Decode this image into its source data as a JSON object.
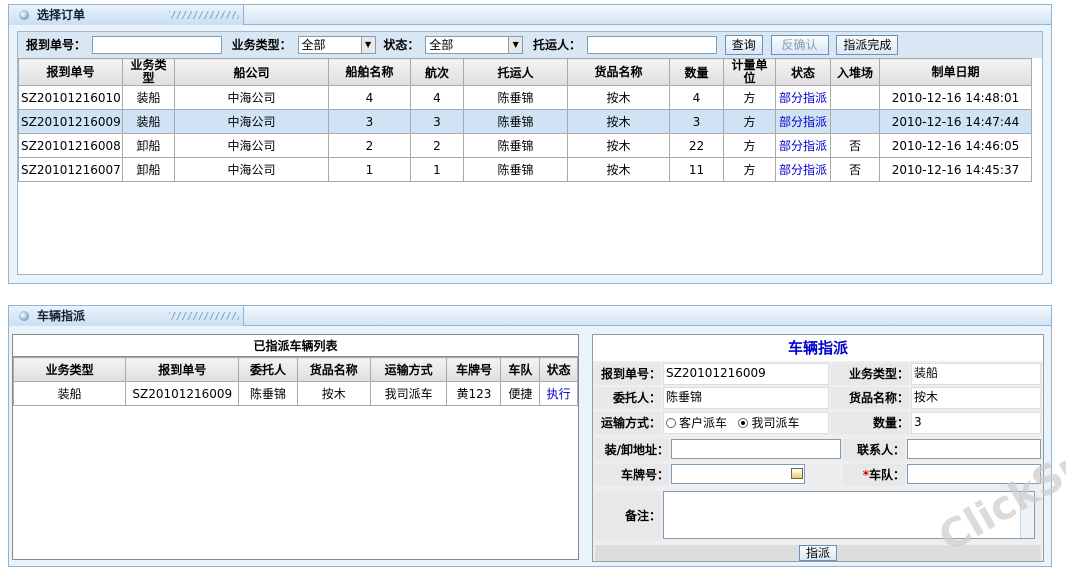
{
  "top_panel": {
    "title": "选择订单",
    "filters": {
      "order_no_label": "报到单号：",
      "order_no_value": "",
      "biz_type_label": "业务类型：",
      "biz_type_value": "全部",
      "status_label": "状态：",
      "status_value": "全部",
      "shipper_label": "托运人：",
      "shipper_value": ""
    },
    "buttons": {
      "query": "查询",
      "unconfirm": "反确认",
      "dispatch_done": "指派完成"
    },
    "columns": [
      "报到单号",
      "业务类型",
      "船公司",
      "船舶名称",
      "航次",
      "托运人",
      "货品名称",
      "数量",
      "计量单位",
      "状态",
      "入堆场",
      "制单日期"
    ],
    "rows": [
      [
        "SZ20101216010",
        "装船",
        "中海公司",
        "4",
        "4",
        "陈垂锦",
        "按木",
        "4",
        "方",
        "部分指派",
        "",
        "2010-12-16 14:48:01"
      ],
      [
        "SZ20101216009",
        "装船",
        "中海公司",
        "3",
        "3",
        "陈垂锦",
        "按木",
        "3",
        "方",
        "部分指派",
        "",
        "2010-12-16 14:47:44"
      ],
      [
        "SZ20101216008",
        "卸船",
        "中海公司",
        "2",
        "2",
        "陈垂锦",
        "按木",
        "22",
        "方",
        "部分指派",
        "否",
        "2010-12-16 14:46:05"
      ],
      [
        "SZ20101216007",
        "卸船",
        "中海公司",
        "1",
        "1",
        "陈垂锦",
        "按木",
        "11",
        "方",
        "部分指派",
        "否",
        "2010-12-16 14:45:37"
      ]
    ],
    "selected_row": 1
  },
  "bottom_panel": {
    "title": "车辆指派",
    "list": {
      "title": "已指派车辆列表",
      "columns": [
        "业务类型",
        "报到单号",
        "委托人",
        "货品名称",
        "运输方式",
        "车牌号",
        "车队",
        "状态"
      ],
      "rows": [
        [
          "装船",
          "SZ20101216009",
          "陈垂锦",
          "按木",
          "我司派车",
          "黄123",
          "便捷",
          "执行"
        ]
      ]
    },
    "form": {
      "title": "车辆指派",
      "order_no_label": "报到单号：",
      "order_no_value": "SZ20101216009",
      "biz_type_label": "业务类型：",
      "biz_type_value": "装船",
      "client_label": "委托人：",
      "client_value": "陈垂锦",
      "goods_label": "货品名称：",
      "goods_value": "按木",
      "transport_label": "运输方式：",
      "transport_opt1": "客户派车",
      "transport_opt2": "我司派车",
      "qty_label": "数量：",
      "qty_value": "3",
      "address_label": "装/卸地址：",
      "contact_label": "联系人：",
      "plate_label": "车牌号：",
      "fleet_label": "车队：",
      "remark_label": "备注：",
      "submit": "指派"
    }
  },
  "watermark": "ClickSun"
}
